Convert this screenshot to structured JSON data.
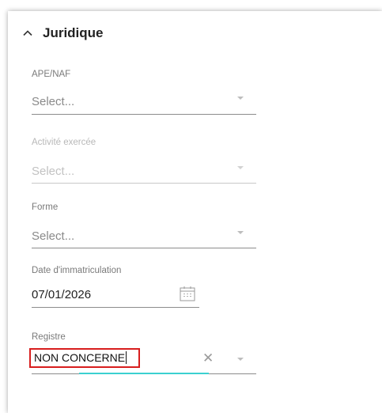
{
  "section": {
    "title": "Juridique",
    "toggle_icon": "chevron-up-icon"
  },
  "fields": {
    "ape_naf": {
      "label": "APE/NAF",
      "placeholder": "Select..."
    },
    "activite": {
      "label": "Activité exercée",
      "placeholder": "Select...",
      "disabled": true
    },
    "forme": {
      "label": "Forme",
      "placeholder": "Select..."
    },
    "date_immatriculation": {
      "label": "Date d'immatriculation",
      "value": "07/01/2026",
      "icon": "calendar-icon"
    },
    "registre": {
      "label": "Registre",
      "value": "NON CONCERNE",
      "clear_icon": "close-icon"
    }
  },
  "colors": {
    "highlight_border": "#d81e1e",
    "focus_accent": "#3cd0d0"
  }
}
